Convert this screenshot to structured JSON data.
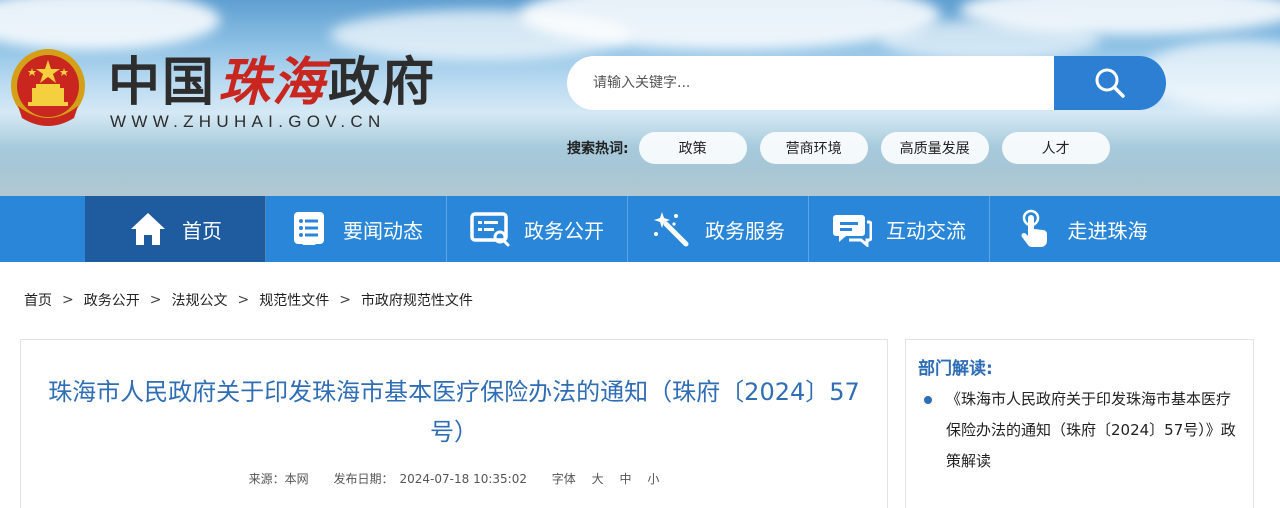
{
  "header": {
    "logo_text_1": "中国",
    "logo_text_2": "珠海",
    "logo_text_3": "政府",
    "logo_url": "WWW.ZHUHAI.GOV.CN",
    "search": {
      "placeholder": "请输入关键字..."
    },
    "hot_label": "搜索热词:",
    "hot_tags": [
      "政策",
      "营商环境",
      "高质量发展",
      "人才"
    ]
  },
  "nav": {
    "items": [
      {
        "label": "首页",
        "icon": "home-icon"
      },
      {
        "label": "要闻动态",
        "icon": "news-list-icon"
      },
      {
        "label": "政务公开",
        "icon": "open-affairs-icon"
      },
      {
        "label": "政务服务",
        "icon": "magic-wand-icon"
      },
      {
        "label": "互动交流",
        "icon": "chat-bubbles-icon"
      },
      {
        "label": "走进珠海",
        "icon": "hand-pointer-icon"
      }
    ]
  },
  "breadcrumb": [
    "首页",
    "政务公开",
    "法规公文",
    "规范性文件",
    "市政府规范性文件"
  ],
  "breadcrumb_separator": ">",
  "article": {
    "title": "珠海市人民政府关于印发珠海市基本医疗保险办法的通知（珠府〔2024〕57号）",
    "source_label": "来源：本网",
    "date_label": "发布日期：",
    "date": "2024-07-18 10:35:02",
    "font_label": "字体",
    "font_large": "大",
    "font_medium": "中",
    "font_small": "小"
  },
  "side": {
    "title": "部门解读:",
    "items": [
      "《珠海市人民政府关于印发珠海市基本医疗保险办法的通知（珠府〔2024〕57号）》政策解读"
    ]
  },
  "colors": {
    "nav_bg": "#2a86d9",
    "nav_active": "#1f5c9f",
    "title_blue": "#2f6db5",
    "logo_red": "#c8261f"
  }
}
